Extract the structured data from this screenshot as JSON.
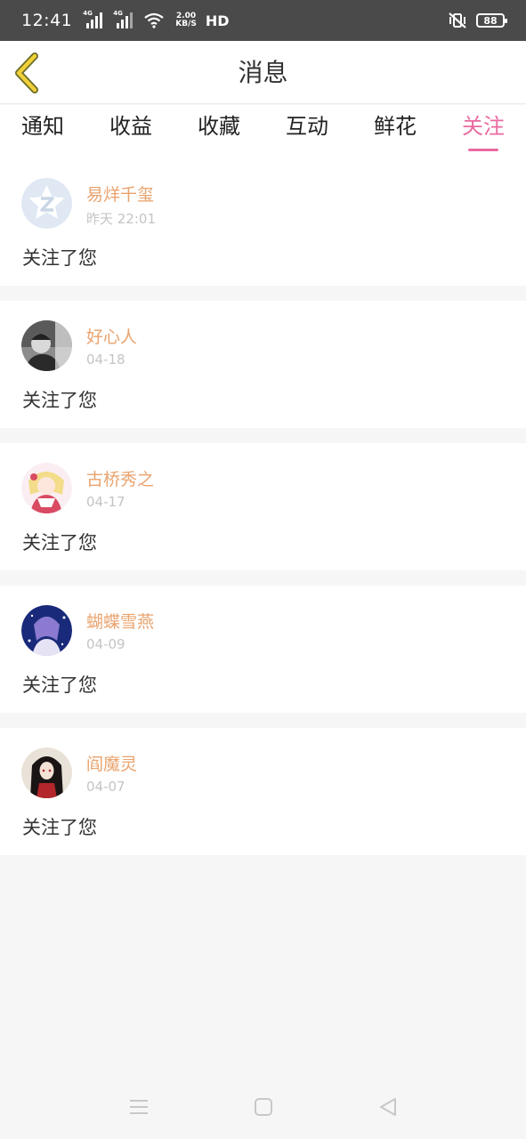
{
  "status": {
    "time": "12:41",
    "sim1": "4G",
    "sim2": "4G",
    "speed_value": "2.00",
    "speed_unit": "KB/S",
    "hd": "HD",
    "battery": "88"
  },
  "header": {
    "title": "消息"
  },
  "tabs": [
    {
      "label": "通知"
    },
    {
      "label": "收益"
    },
    {
      "label": "收藏"
    },
    {
      "label": "互动"
    },
    {
      "label": "鲜花"
    },
    {
      "label": "关注",
      "active": true
    }
  ],
  "items": [
    {
      "name": "易烊千玺",
      "date": "昨天 22:01",
      "message": "关注了您"
    },
    {
      "name": "好心人",
      "date": "04-18",
      "message": "关注了您"
    },
    {
      "name": "古桥秀之",
      "date": "04-17",
      "message": "关注了您"
    },
    {
      "name": "蝴蝶雪燕",
      "date": "04-09",
      "message": "关注了您"
    },
    {
      "name": "阎魔灵",
      "date": "04-07",
      "message": "关注了您"
    }
  ],
  "colors": {
    "accent": "#e96aa0",
    "username": "#e9a36e",
    "back_arrow": "#f0d038"
  },
  "icons": [
    "back-arrow-icon",
    "signal-icon",
    "wifi-icon",
    "mute-vibrate-icon",
    "battery-icon",
    "menu-icon",
    "home-icon",
    "back-icon"
  ]
}
